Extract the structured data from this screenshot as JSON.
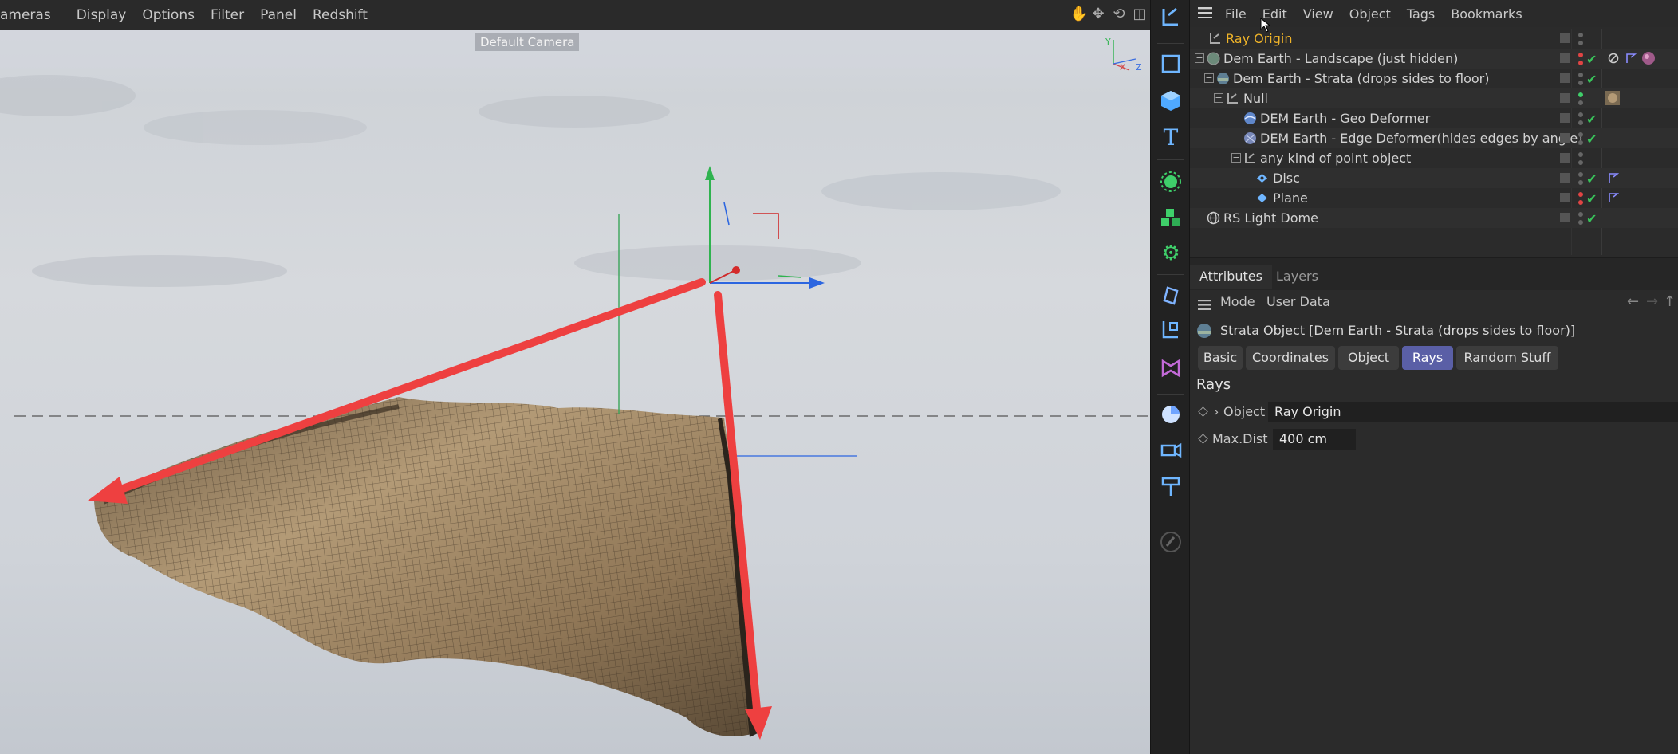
{
  "viewport": {
    "menu": [
      "ameras",
      "Display",
      "Options",
      "Filter",
      "Panel",
      "Redshift"
    ],
    "camera_label": "Default Camera",
    "axis_labels": {
      "y": "Y",
      "x": "X",
      "z": "Z"
    },
    "tools": [
      "hand-icon",
      "move-icon",
      "rotate-icon",
      "maximize-icon"
    ]
  },
  "palette": {
    "icons": [
      "null-icon",
      "cube-outline-icon",
      "cube-icon",
      "text-icon",
      "generator-icon",
      "cloner-icon",
      "gear-icon",
      "deformer-icon",
      "spline-icon",
      "field-icon",
      "camera-icon",
      "light-icon",
      "sketch-icon"
    ]
  },
  "object_manager": {
    "menu": [
      "File",
      "Edit",
      "View",
      "Object",
      "Tags",
      "Bookmarks"
    ],
    "rows": [
      {
        "name": "Ray Origin",
        "highlight": true
      },
      {
        "name": "Dem Earth - Landscape (just hidden)"
      },
      {
        "name": "Dem Earth - Strata (drops sides to floor)"
      },
      {
        "name": "Null"
      },
      {
        "name": "DEM Earth - Geo Deformer"
      },
      {
        "name": "DEM Earth - Edge Deformer(hides edges by angle)"
      },
      {
        "name": "any kind of point object"
      },
      {
        "name": "Disc"
      },
      {
        "name": "Plane"
      },
      {
        "name": "RS Light Dome"
      }
    ],
    "highlight_color": "#f0b429",
    "check_color": "#38c35a"
  },
  "attributes": {
    "tabs": [
      "Attributes",
      "Layers"
    ],
    "toolbar": {
      "mode": "Mode",
      "user_data": "User Data"
    },
    "title": "Strata Object [Dem Earth - Strata (drops sides to floor)]",
    "buttons": [
      "Basic",
      "Coordinates",
      "Object",
      "Rays",
      "Random Stuff"
    ],
    "active_button": "Rays",
    "section": "Rays",
    "params": [
      {
        "label": "Object",
        "value": "Ray Origin"
      },
      {
        "label": "Max.Dist",
        "value": "400 cm"
      }
    ],
    "accent_color": "#5a5fa6"
  }
}
